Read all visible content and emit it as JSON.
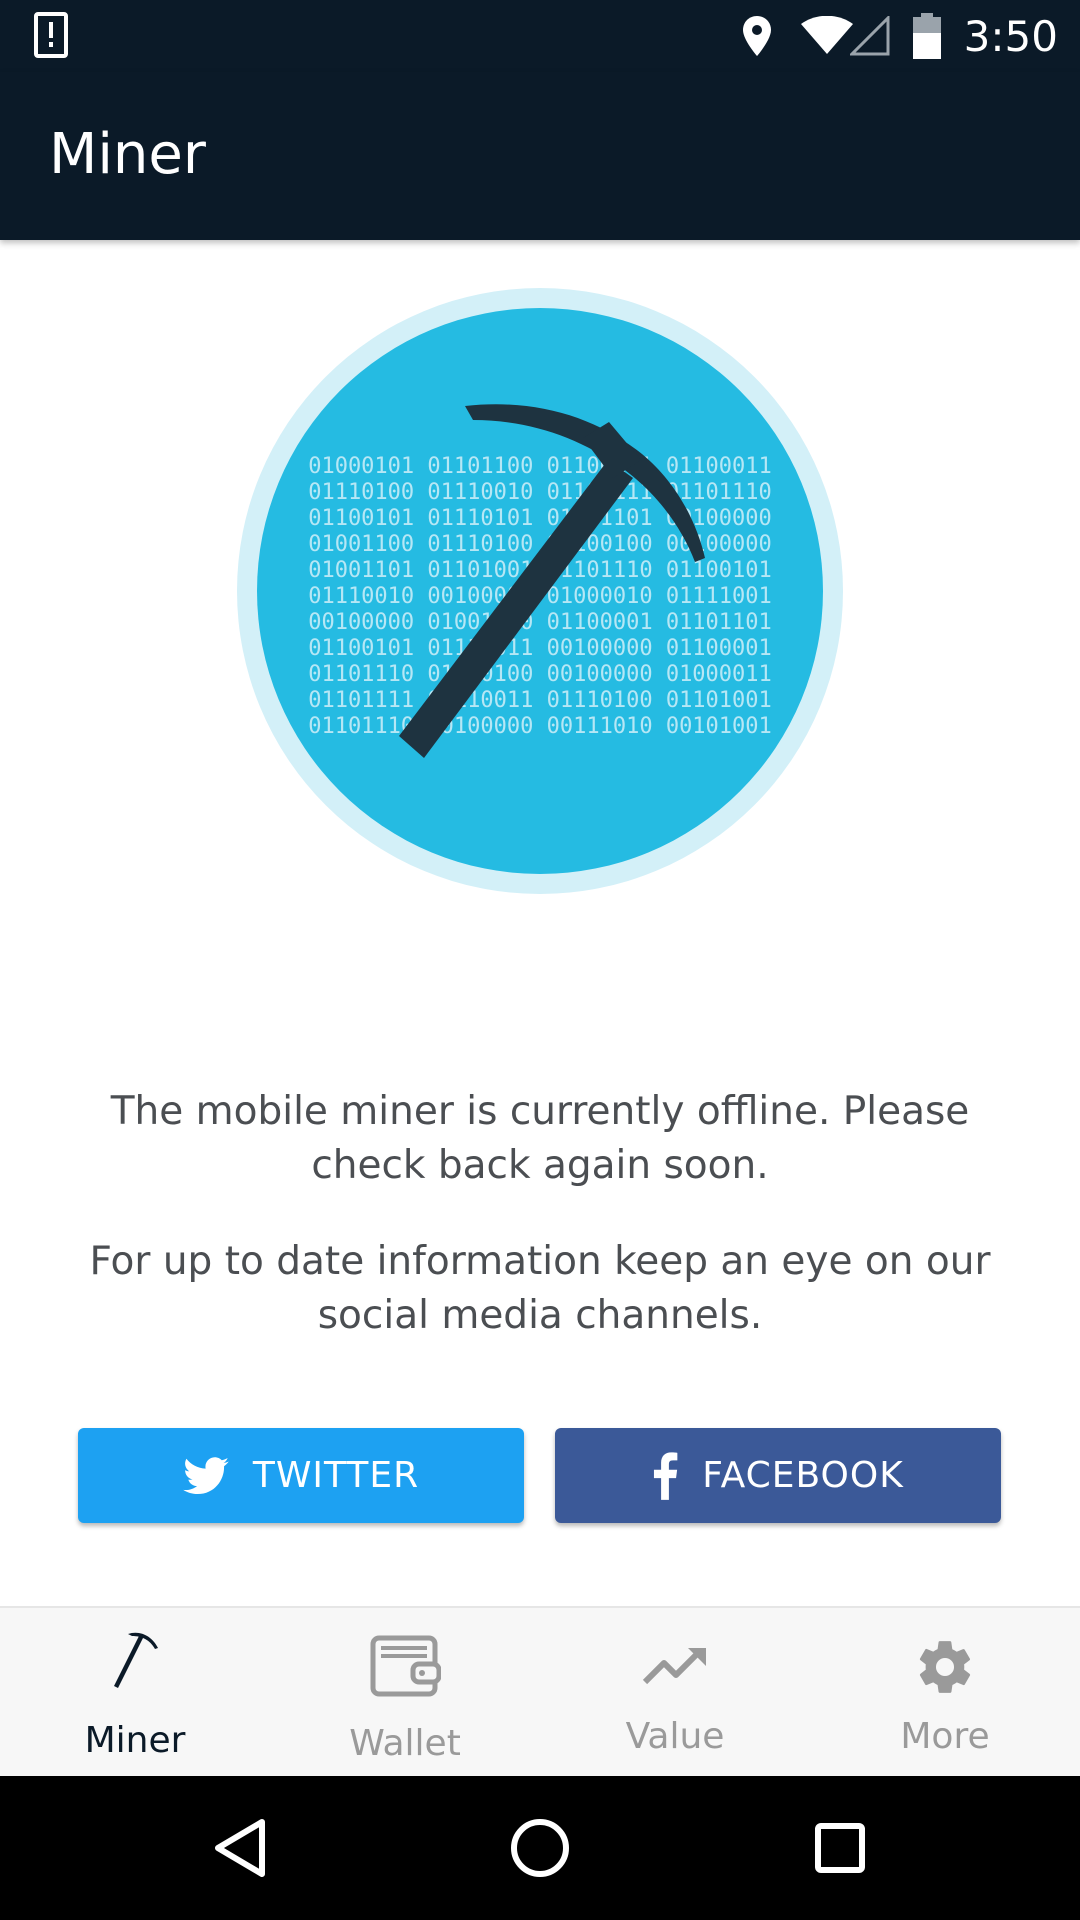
{
  "status_bar": {
    "time": "3:50",
    "icons": [
      "alert-icon",
      "location-icon",
      "wifi-icon",
      "cell-signal-icon",
      "battery-icon"
    ]
  },
  "app_bar": {
    "title": "Miner"
  },
  "hero": {
    "icon": "pickaxe-icon",
    "binary_lines": [
      "01000101 01101100 01100101 01100011",
      "01110100 01110010 01101111 01101110",
      "01100101 01110101 01101101 00100000",
      "01001100 01110100 01100100 00100000",
      "01001101 01101001 01101110 01100101",
      "01110010 00100000 01000010 01111001",
      "00100000 01001010 01100001 01101101",
      "01100101 01110011 00100000 01100001",
      "01101110 01100100 00100000 01000011",
      "01101111 01110011 01110100 01101001",
      "01101110 00100000 00111010 00101001"
    ],
    "colors": {
      "outer": "#d3f0f8",
      "inner": "#25bbe2",
      "pickaxe": "#1e3340",
      "binary": "#b6e7f5"
    }
  },
  "messages": {
    "offline": "The mobile miner is currently offline. Please check back again soon.",
    "social": "For up to date information keep an eye on our social media channels."
  },
  "buttons": {
    "twitter": {
      "label": "TWITTER",
      "icon": "twitter-icon",
      "color": "#1da1f2"
    },
    "facebook": {
      "label": "FACEBOOK",
      "icon": "facebook-icon",
      "color": "#3b5998"
    }
  },
  "bottom_nav": {
    "items": [
      {
        "label": "Miner",
        "icon": "pickaxe-icon",
        "active": true
      },
      {
        "label": "Wallet",
        "icon": "wallet-icon",
        "active": false
      },
      {
        "label": "Value",
        "icon": "trending-up-icon",
        "active": false
      },
      {
        "label": "More",
        "icon": "gear-icon",
        "active": false
      }
    ]
  },
  "system_nav": {
    "icons": [
      "back-icon",
      "home-icon",
      "recents-icon"
    ]
  }
}
